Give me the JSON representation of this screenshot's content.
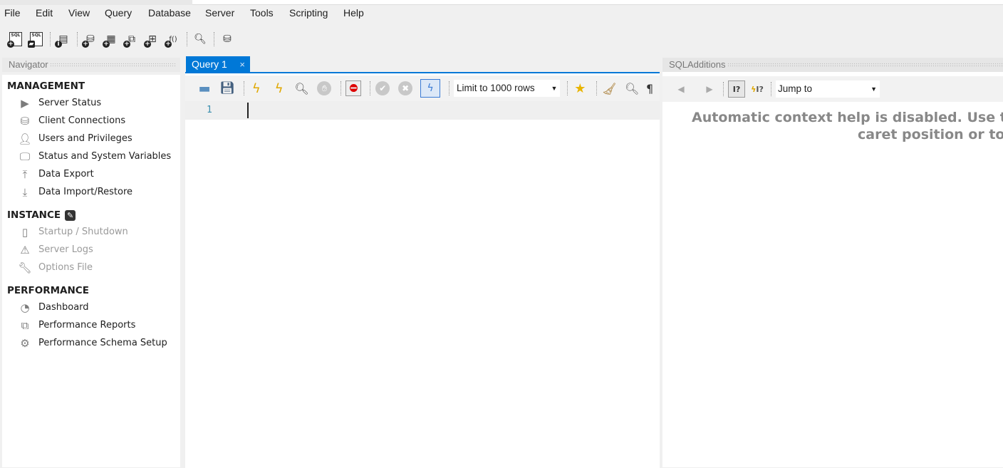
{
  "menu": [
    "File",
    "Edit",
    "View",
    "Query",
    "Database",
    "Server",
    "Tools",
    "Scripting",
    "Help"
  ],
  "main_toolbar": [
    "new-sql-tab-icon",
    "open-sql-script-icon",
    "schema-inspector-icon",
    "create-schema-icon",
    "create-table-icon",
    "create-view-icon",
    "create-procedure-icon",
    "create-function-icon",
    "search-table-data-icon",
    "reconnect-icon"
  ],
  "navigator": {
    "title": "Navigator",
    "sections": [
      {
        "title": "MANAGEMENT",
        "items": [
          {
            "label": "Server Status",
            "icon": "play-circle-icon",
            "disabled": false
          },
          {
            "label": "Client Connections",
            "icon": "database-connection-icon",
            "disabled": false
          },
          {
            "label": "Users and Privileges",
            "icon": "user-icon",
            "disabled": false
          },
          {
            "label": "Status and System Variables",
            "icon": "monitor-icon",
            "disabled": false
          },
          {
            "label": "Data Export",
            "icon": "upload-icon",
            "disabled": false
          },
          {
            "label": "Data Import/Restore",
            "icon": "download-icon",
            "disabled": false
          }
        ]
      },
      {
        "title": "INSTANCE",
        "items": [
          {
            "label": "Startup / Shutdown",
            "icon": "traffic-light-icon",
            "disabled": true
          },
          {
            "label": "Server Logs",
            "icon": "warning-icon",
            "disabled": true
          },
          {
            "label": "Options File",
            "icon": "wrench-icon",
            "disabled": true
          }
        ]
      },
      {
        "title": "PERFORMANCE",
        "items": [
          {
            "label": "Dashboard",
            "icon": "gauge-icon",
            "disabled": false
          },
          {
            "label": "Performance Reports",
            "icon": "reports-icon",
            "disabled": false
          },
          {
            "label": "Performance Schema Setup",
            "icon": "schema-setup-icon",
            "disabled": false
          }
        ]
      }
    ]
  },
  "query": {
    "tab_label": "Query 1",
    "close": "×",
    "limit_select": "Limit to 1000 rows",
    "line_numbers": [
      "1"
    ]
  },
  "sql_additions": {
    "title": "SQLAdditions",
    "jump_to": "Jump to",
    "help_line1": "Automatic context help is disabled. Use the",
    "help_line2": "caret position or to t"
  },
  "colors": {
    "accent": "#0078d7",
    "help_text": "#888888"
  }
}
